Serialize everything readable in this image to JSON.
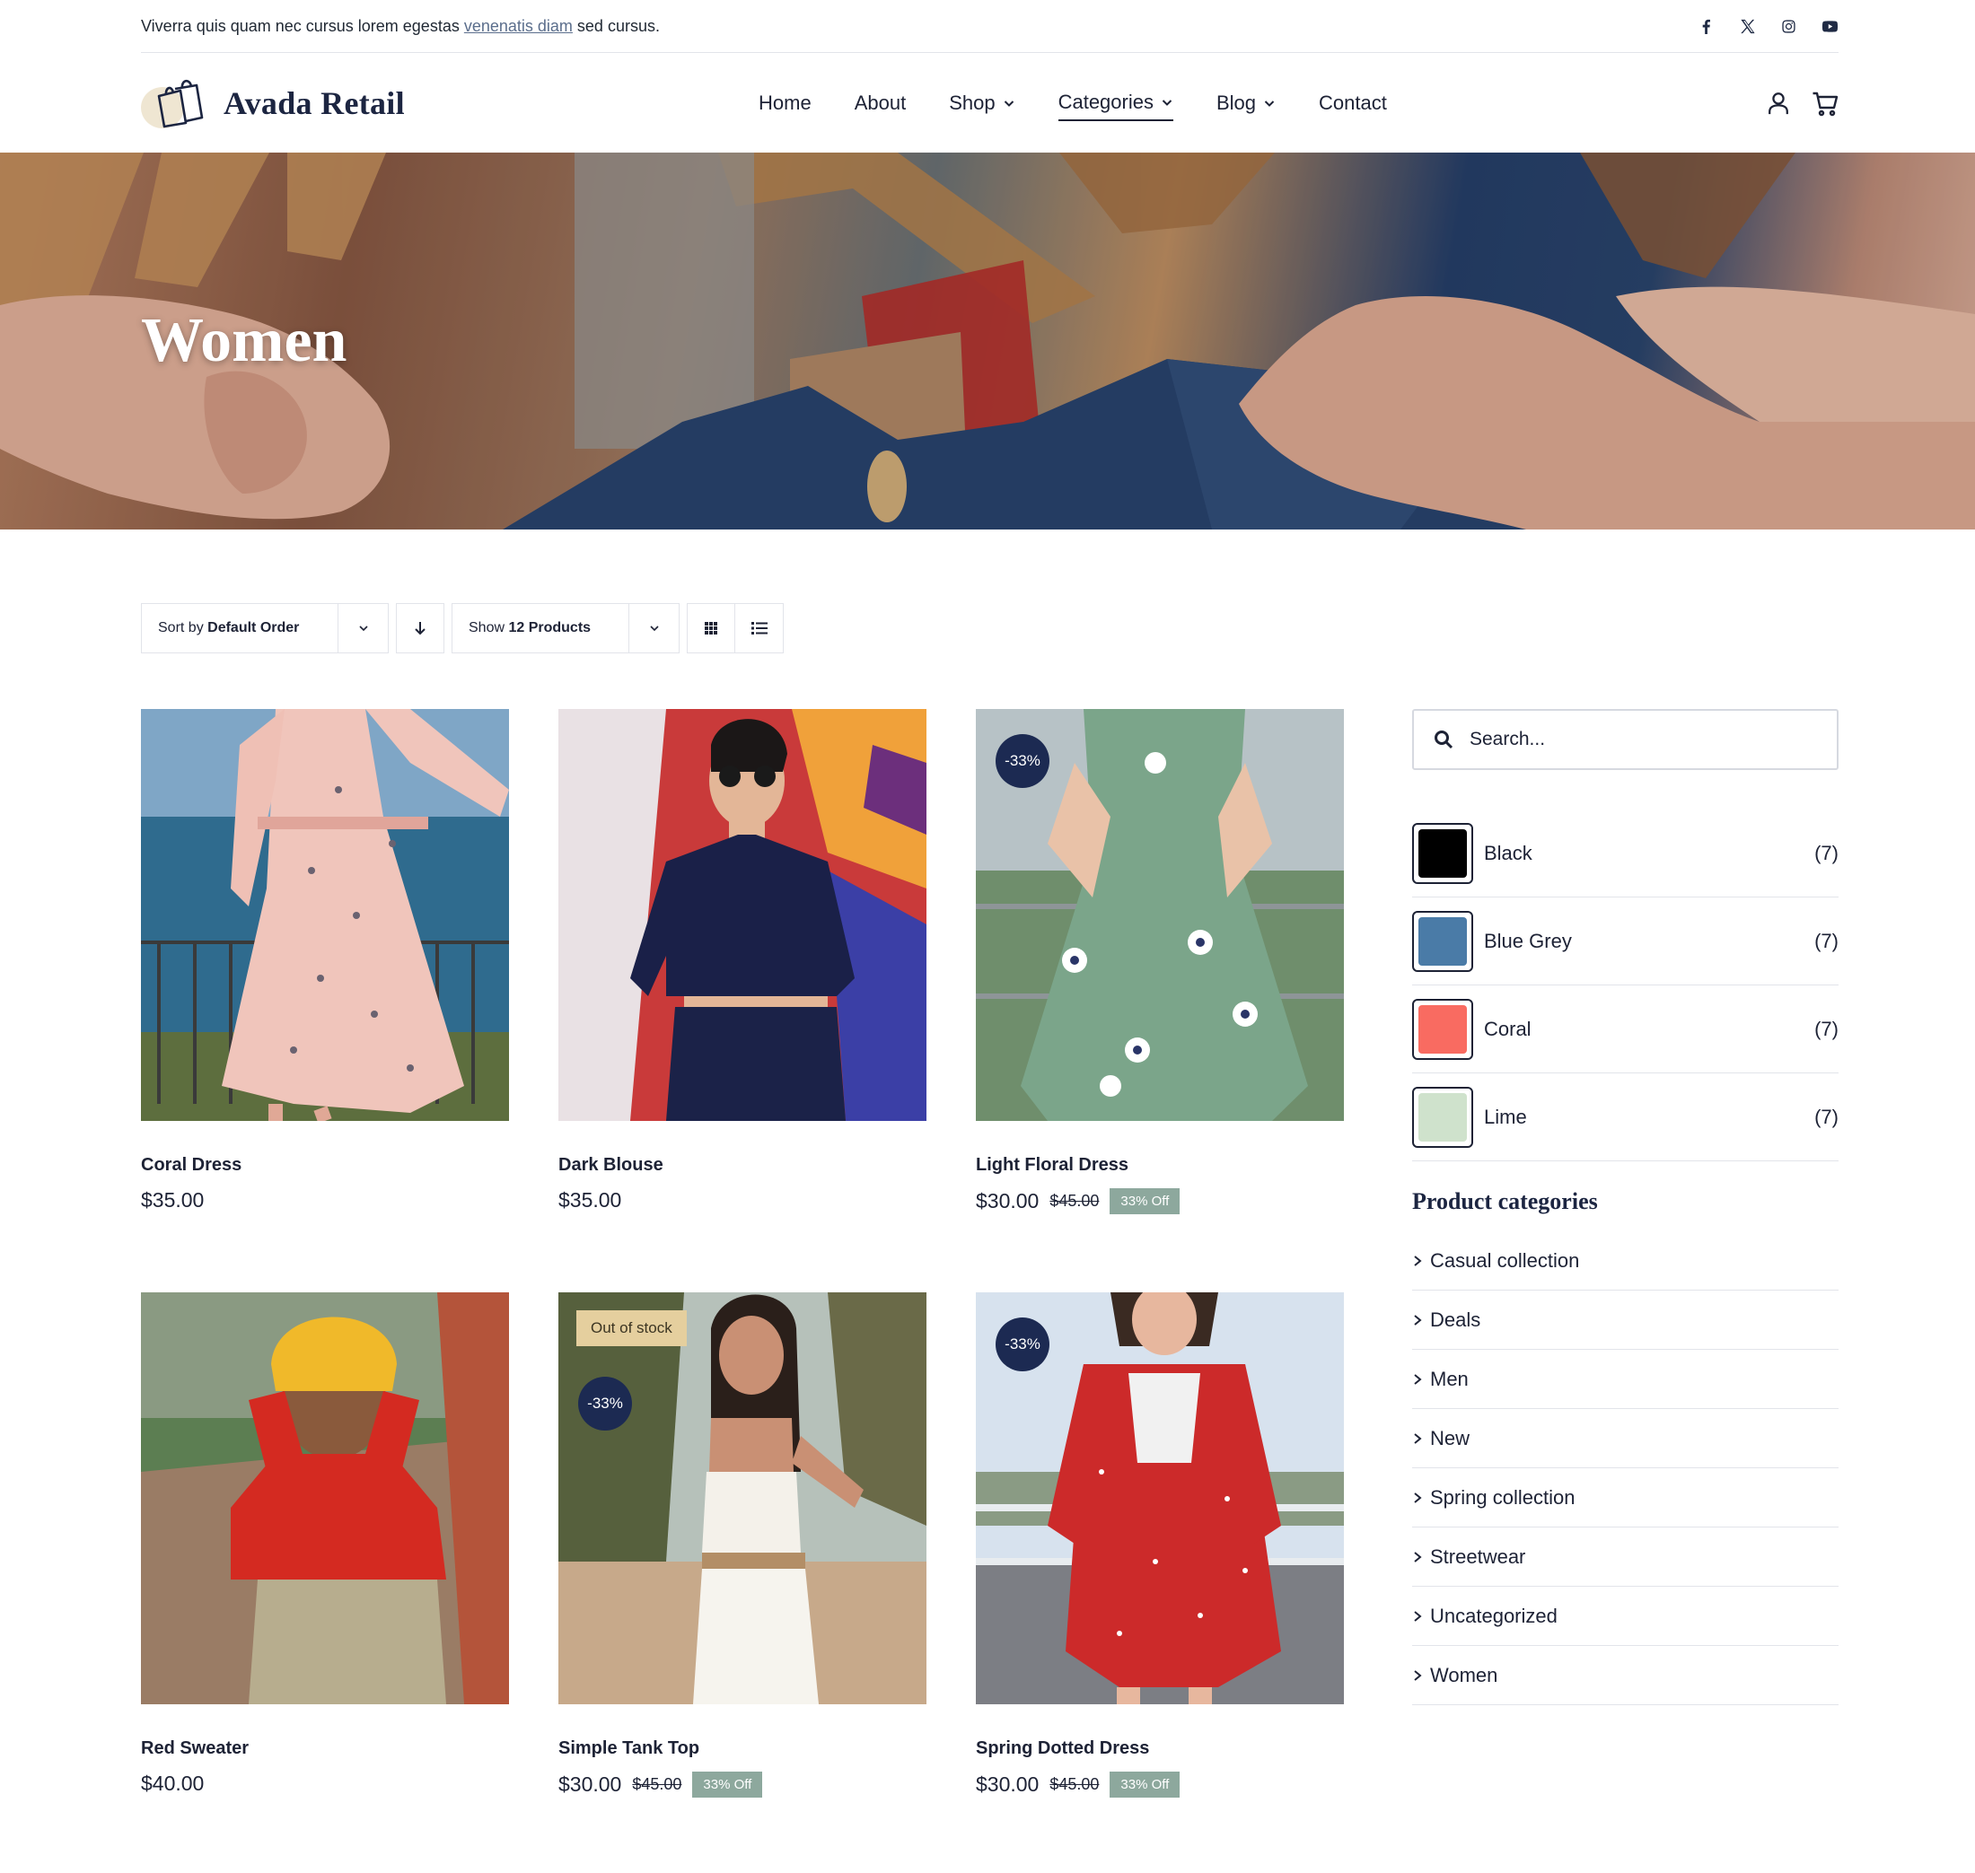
{
  "topbar": {
    "text_before": "Viverra quis quam nec cursus lorem egestas ",
    "link": "venenatis diam",
    "text_after": " sed cursus.",
    "social": [
      "facebook-icon",
      "x-icon",
      "instagram-icon",
      "youtube-icon"
    ]
  },
  "header": {
    "logo_text": "Avada Retail",
    "nav": [
      {
        "label": "Home",
        "dropdown": false
      },
      {
        "label": "About",
        "dropdown": false
      },
      {
        "label": "Shop",
        "dropdown": true
      },
      {
        "label": "Categories",
        "dropdown": true,
        "active": true
      },
      {
        "label": "Blog",
        "dropdown": true
      },
      {
        "label": "Contact",
        "dropdown": false
      }
    ],
    "icons": [
      "user-icon",
      "cart-icon"
    ]
  },
  "hero": {
    "title": "Women"
  },
  "toolbar": {
    "sort_prefix": "Sort by ",
    "sort_value": "Default Order",
    "show_prefix": "Show ",
    "show_value": "12 Products"
  },
  "products": [
    {
      "name": "Coral Dress",
      "price": "$35.00"
    },
    {
      "name": "Dark Blouse",
      "price": "$35.00"
    },
    {
      "name": "Light Floral Dress",
      "price": "$30.00",
      "old_price": "$45.00",
      "off": "33% Off",
      "badge": "-33%"
    },
    {
      "name": "Red Sweater",
      "price": "$40.00"
    },
    {
      "name": "Simple Tank Top",
      "price": "$30.00",
      "old_price": "$45.00",
      "off": "33% Off",
      "badge": "-33%",
      "stock": "Out of stock"
    },
    {
      "name": "Spring Dotted Dress",
      "price": "$30.00",
      "old_price": "$45.00",
      "off": "33% Off",
      "badge": "-33%"
    }
  ],
  "sidebar": {
    "search_placeholder": "Search...",
    "colors": [
      {
        "name": "Black",
        "count": "(7)",
        "hex": "#000000"
      },
      {
        "name": "Blue Grey",
        "count": "(7)",
        "hex": "#4a7ba7"
      },
      {
        "name": "Coral",
        "count": "(7)",
        "hex": "#f96b61"
      },
      {
        "name": "Lime",
        "count": "(7)",
        "hex": "#cfe2cc"
      }
    ],
    "categories_title": "Product categories",
    "categories": [
      "Casual collection",
      "Deals",
      "Men",
      "New",
      "Spring collection",
      "Streetwear",
      "Uncategorized",
      "Women"
    ]
  }
}
